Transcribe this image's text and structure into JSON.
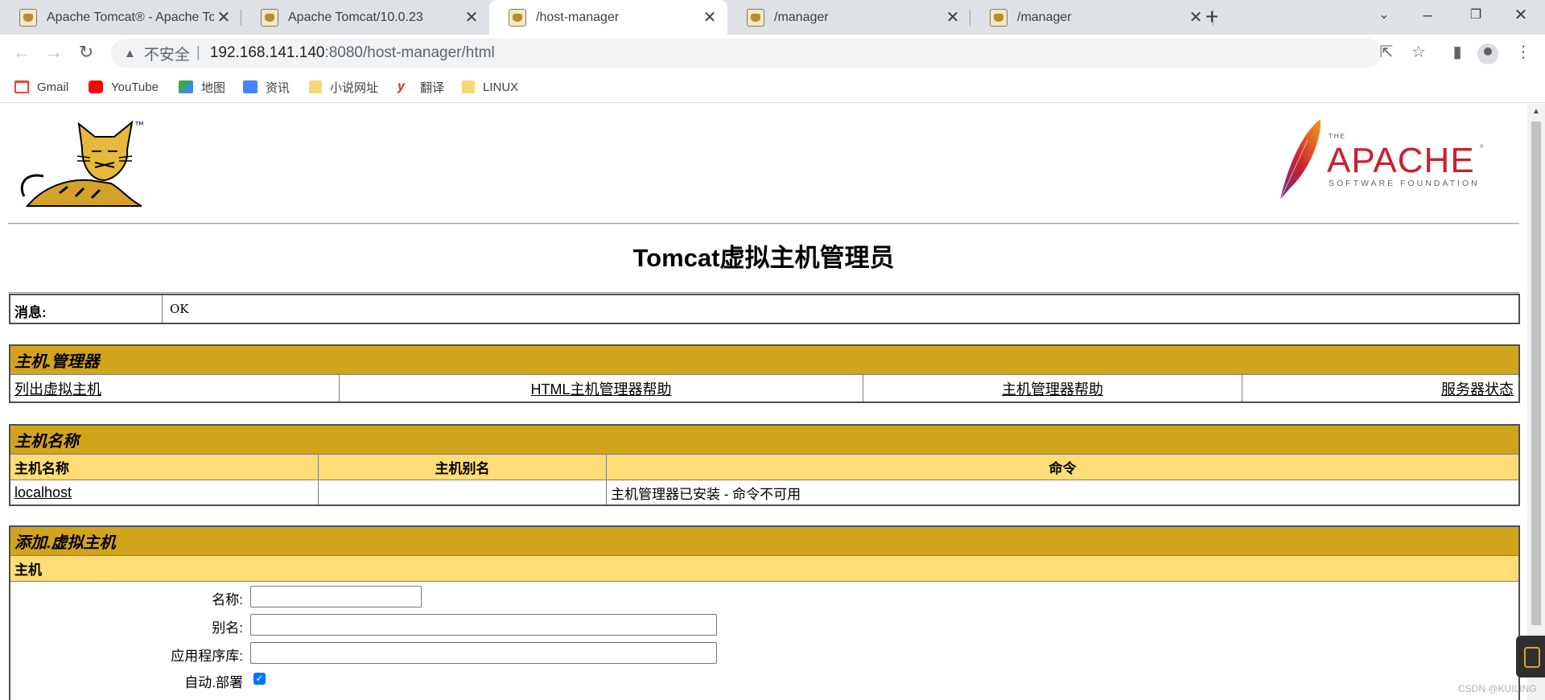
{
  "browser": {
    "tabs": [
      {
        "title": "Apache Tomcat® - Apache To",
        "active": false
      },
      {
        "title": "Apache Tomcat/10.0.23",
        "active": false
      },
      {
        "title": "/host-manager",
        "active": true
      },
      {
        "title": "/manager",
        "active": false
      },
      {
        "title": "/manager",
        "active": false
      }
    ],
    "close_glyph": "✕",
    "new_tab_glyph": "+",
    "address": {
      "security_label": "不安全",
      "separator": "|",
      "host": "192.168.141.140",
      "path": ":8080/host-manager/html"
    },
    "bookmarks": [
      {
        "label": "Gmail",
        "icon": "gmail-icon",
        "color": "#ea4335"
      },
      {
        "label": "YouTube",
        "icon": "youtube-icon",
        "color": "#ff0000"
      },
      {
        "label": "地图",
        "icon": "maps-icon",
        "color": "#34a853"
      },
      {
        "label": "资讯",
        "icon": "news-icon",
        "color": "#4285f4"
      },
      {
        "label": "小说网址",
        "icon": "folder-icon",
        "color": "#f7d774"
      },
      {
        "label": "翻译",
        "icon": "youdao-icon",
        "color": "#e1251b"
      },
      {
        "label": "LINUX",
        "icon": "folder-icon",
        "color": "#f7d774"
      }
    ]
  },
  "page": {
    "title": "Tomcat虚拟主机管理员",
    "message": {
      "label": "消息:",
      "value": "OK"
    },
    "host_manager": {
      "heading": "主机.管理器",
      "links": [
        "列出虚拟主机",
        "HTML主机管理器帮助",
        "主机管理器帮助",
        "服务器状态"
      ]
    },
    "host_names": {
      "heading": "主机名称",
      "columns": [
        "主机名称",
        "主机别名",
        "命令"
      ],
      "rows": [
        {
          "name": "localhost",
          "aliases": "",
          "commands": "主机管理器已安装 - 命令不可用"
        }
      ]
    },
    "add_host": {
      "heading": "添加.虚拟主机",
      "subheading": "主机",
      "fields": [
        {
          "label": "名称:",
          "value": ""
        },
        {
          "label": "别名:",
          "value": ""
        },
        {
          "label": "应用程序库:",
          "value": ""
        }
      ],
      "auto_deploy": {
        "label": "自动.部署",
        "checked": true
      }
    }
  },
  "watermark": "CSDN @KUILING",
  "colors": {
    "header_gold": "#d2a41c",
    "subheader_yellow": "#ffdc75",
    "checkbox_blue": "#0075ff"
  }
}
